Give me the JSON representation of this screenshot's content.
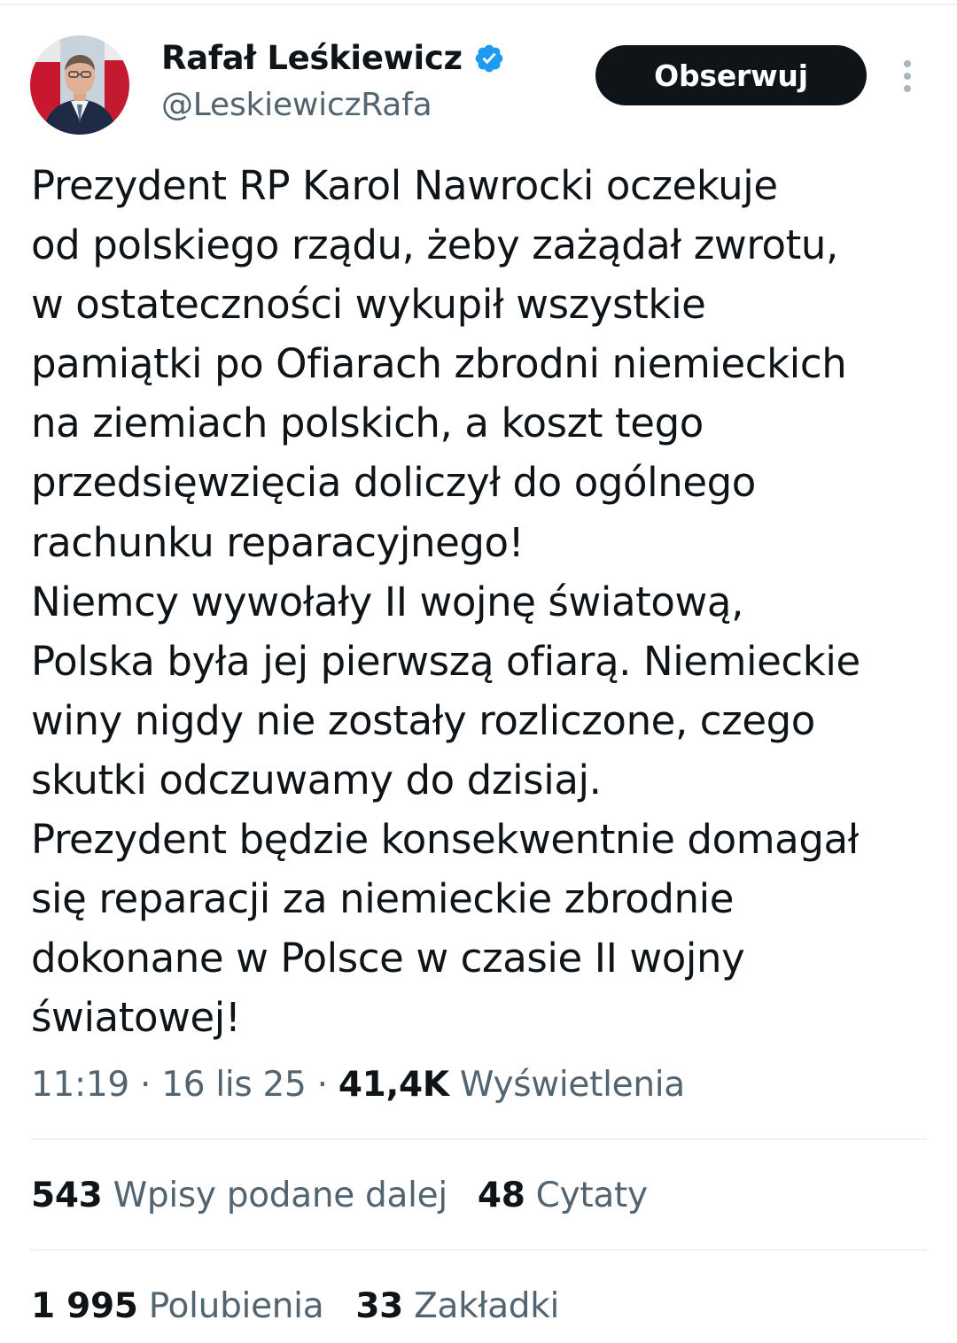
{
  "author": {
    "display_name": "Rafał Leśkiewicz",
    "handle": "@LeskiewiczRafa",
    "verified": true
  },
  "actions": {
    "follow_label": "Obserwuj",
    "more_icon": "more-vertical-icon"
  },
  "tweet": {
    "text": "Prezydent RP Karol Nawrocki oczekuje\nod polskiego rządu, żeby zażądał zwrotu,\nw ostateczności wykupił wszystkie\npamiątki po Ofiarach zbrodni niemieckich\nna ziemiach polskich, a koszt tego\nprzedsięwzięcia doliczył do ogólnego\nrachunku reparacyjnego!\nNiemcy wywołały II wojnę światową,\nPolska była jej pierwszą ofiarą. Niemieckie\nwiny nigdy nie zostały rozliczone, czego\nskutki odczuwamy do dzisiaj.\nPrezydent będzie konsekwentnie domagał\nsię reparacji za niemieckie zbrodnie\ndokonane w Polsce w czasie II wojny\nświatowej!"
  },
  "meta": {
    "time": "11:19",
    "separator": " · ",
    "date": "16 lis 25",
    "views_count": "41,4K",
    "views_label": "Wyświetlenia"
  },
  "stats": {
    "reposts_count": "543",
    "reposts_label": "Wpisy podane dalej",
    "quotes_count": "48",
    "quotes_label": "Cytaty",
    "likes_count": "1 995",
    "likes_label": "Polubienia",
    "bookmarks_count": "33",
    "bookmarks_label": "Zakładki"
  },
  "colors": {
    "text_primary": "#0f1419",
    "text_secondary": "#536471",
    "verified_blue": "#1d9bf0",
    "divider": "#eff3f4",
    "button_bg": "#0f1419"
  }
}
